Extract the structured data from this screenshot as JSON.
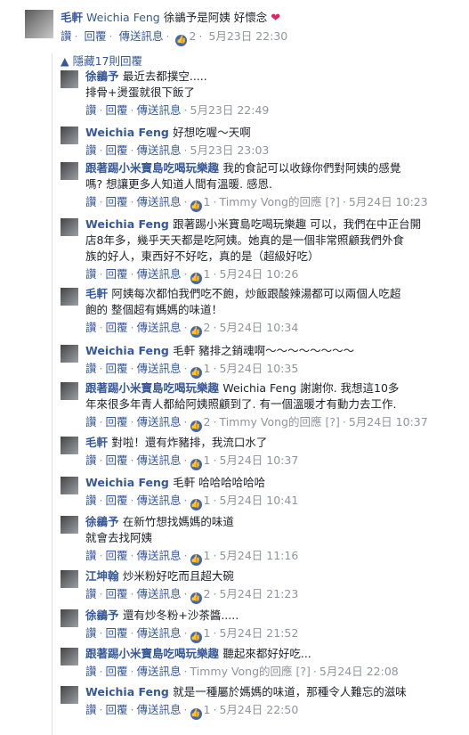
{
  "top": {
    "author": "毛軒",
    "text": "Weichia Feng 徐鶲予是阿姨 好懷念",
    "mention": "Weichia Feng",
    "rest": " 徐鶲予是阿姨 好懷念",
    "actions": {
      "like": "讚",
      "reply": "回覆",
      "message": "傳送訊息",
      "likes": "2",
      "time": "5月23日 22:30"
    }
  },
  "hidden_label": "隱藏17則回覆",
  "replies": [
    {
      "author": "徐鶲予",
      "lines": [
        "最近去都撲空.....",
        "排骨+燙蛋就很下飯了"
      ],
      "likes": "",
      "time": "5月23日 22:49",
      "extra": ""
    },
    {
      "author": "Weichia Feng",
      "lines": [
        "好想吃喔～天啊"
      ],
      "likes": "",
      "time": "5月23日 23:03",
      "extra": ""
    },
    {
      "author": "跟著踢小米寶島吃喝玩樂趣",
      "lines": [
        "我的食記可以收錄你們對阿姨的感覺",
        "嗎? 想讓更多人知道人間有溫暖. 感恩."
      ],
      "likes": "1",
      "extra": "Timmy Vong的回應 [?]",
      "time": "5月24日 10:23"
    },
    {
      "author": "Weichia Feng",
      "lines": [
        "跟著踢小米寶島吃喝玩樂趣 可以，我們在中正台開",
        "店8年多，幾乎天天都是吃阿姨。她真的是一個非常照顧我們外食",
        "族的好人，東西好不好吃，真的是（超級好吃）"
      ],
      "likes": "1",
      "time": "5月24日 10:26",
      "extra": ""
    },
    {
      "author": "毛軒",
      "lines": [
        "阿姨每次都怕我們吃不飽，炒飯跟酸辣湯都可以兩個人吃超",
        "飽的 整個超有媽媽的味道！"
      ],
      "likes": "2",
      "time": "5月24日 10:34",
      "extra": ""
    },
    {
      "author": "Weichia Feng",
      "lines": [
        "毛軒 豬排之銷魂啊～～～～～～～～"
      ],
      "likes": "1",
      "time": "5月24日 10:35",
      "extra": ""
    },
    {
      "author": "跟著踢小米寶島吃喝玩樂趣",
      "lines": [
        "Weichia Feng 謝謝你. 我想這10多",
        "年來很多年青人都給阿姨照顧到了. 有一個溫暖才有動力去工作."
      ],
      "likes": "2",
      "extra": "Timmy Vong的回應 [?]",
      "time": "5月24日 10:37"
    },
    {
      "author": "毛軒",
      "lines": [
        "對啦！還有炸豬排，我流口水了"
      ],
      "likes": "1",
      "time": "5月24日 10:37",
      "extra": ""
    },
    {
      "author": "Weichia Feng",
      "lines": [
        "毛軒 哈哈哈哈哈哈"
      ],
      "likes": "1",
      "time": "5月24日 10:41",
      "extra": ""
    },
    {
      "author": "徐鶲予",
      "lines": [
        "在新竹想找媽媽的味道",
        "就會去找阿姨"
      ],
      "likes": "1",
      "time": "5月24日 11:16",
      "extra": ""
    },
    {
      "author": "江坤翰",
      "lines": [
        "炒米粉好吃而且超大碗"
      ],
      "likes": "2",
      "time": "5月24日 21:23",
      "extra": ""
    },
    {
      "author": "徐鶲予",
      "lines": [
        "還有炒冬粉+沙茶醬....."
      ],
      "likes": "1",
      "time": "5月24日 21:52",
      "extra": ""
    },
    {
      "author": "跟著踢小米寶島吃喝玩樂趣",
      "lines": [
        "聽起來都好好吃..."
      ],
      "likes": "",
      "extra": "Timmy Vong的回應 [?]",
      "time": "5月24日 22:08"
    },
    {
      "author": "Weichia Feng",
      "lines": [
        "就是一種屬於媽媽的味道，那種令人難忘的滋味"
      ],
      "likes": "1",
      "time": "5月24日 22:50",
      "extra": ""
    }
  ],
  "action_labels": {
    "like": "讚",
    "reply": "回覆",
    "message": "傳送訊息"
  }
}
